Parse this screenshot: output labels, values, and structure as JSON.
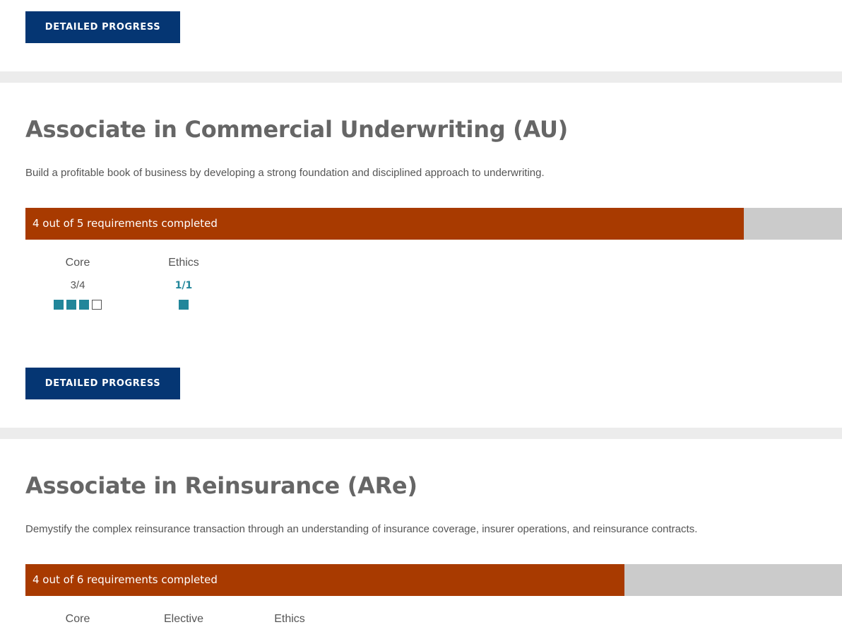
{
  "colors": {
    "button": "#053673",
    "progress_fill": "#a83a00",
    "progress_track": "#cbcbcb",
    "requirement_box": "#21869a",
    "title": "#666666"
  },
  "top_section": {
    "button_label": "DETAILED PROGRESS"
  },
  "programs": [
    {
      "title": "Associate in Commercial Underwriting (AU)",
      "description": "Build a profitable book of business by developing a strong foundation and disciplined approach to underwriting.",
      "progress_label": "4 out of 5 requirements completed",
      "progress_fraction": 0.88,
      "requirements": [
        {
          "name": "Core",
          "count": "3/4",
          "completed": 3,
          "total": 4
        },
        {
          "name": "Ethics",
          "count": "1/1",
          "completed": 1,
          "total": 1
        }
      ],
      "button_label": "DETAILED PROGRESS"
    },
    {
      "title": "Associate in Reinsurance (ARe)",
      "description": "Demystify the complex reinsurance transaction through an understanding of insurance coverage, insurer operations, and reinsurance contracts.",
      "progress_label": "4 out of 6 requirements completed",
      "progress_fraction": 0.7335,
      "requirements": [
        {
          "name": "Core"
        },
        {
          "name": "Elective"
        },
        {
          "name": "Ethics"
        }
      ]
    }
  ]
}
